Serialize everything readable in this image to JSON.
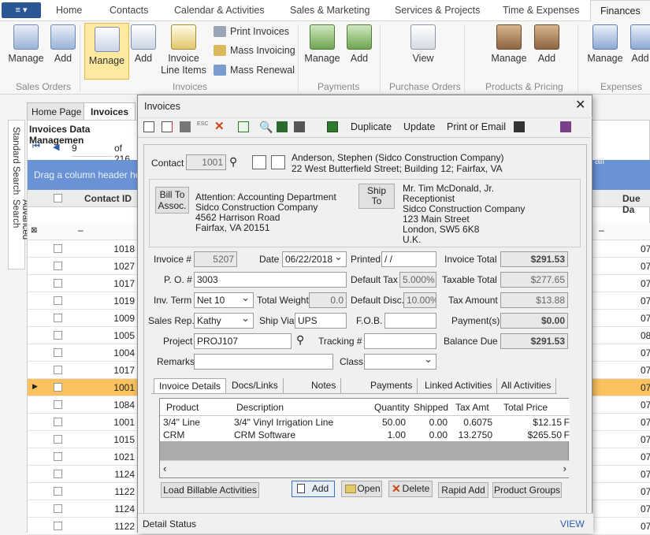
{
  "menu": {
    "app_button": "≡ ▾"
  },
  "ribbon_tabs": [
    "Home",
    "Contacts",
    "Calendar & Activities",
    "Sales & Marketing",
    "Services & Projects",
    "Time & Expenses",
    "Finances"
  ],
  "ribbon": {
    "sales_orders": {
      "manage": "Manage",
      "add": "Add",
      "label": "Sales Orders"
    },
    "invoices": {
      "manage": "Manage",
      "add": "Add",
      "line_items": "Invoice Line Items",
      "print": "Print Invoices",
      "mass": "Mass Invoicing",
      "renewal": "Mass Renewal",
      "label": "Invoices"
    },
    "payments": {
      "manage": "Manage",
      "add": "Add",
      "label": "Payments"
    },
    "purchase_orders": {
      "view": "View",
      "label": "Purchase Orders"
    },
    "products": {
      "manage": "Manage",
      "add": "Add",
      "label": "Products & Pricing"
    },
    "expenses": {
      "manage": "Manage",
      "add": "Add",
      "label": "Expenses"
    }
  },
  "background": {
    "tabs": {
      "home": "Home Page",
      "invoices": "Invoices"
    },
    "side": {
      "standard": "Standard Search",
      "advanced": "Advanced Search"
    },
    "title": "Invoices Data Managemen",
    "nav_value": "9",
    "nav_total": "of 216",
    "drag_hint": "Drag a column header he",
    "col_contact": "Contact ID",
    "col_due": "Due Da",
    "col_mail": "ail",
    "rows": [
      {
        "id": "1018",
        "due": "07"
      },
      {
        "id": "1027",
        "due": "07"
      },
      {
        "id": "1017",
        "due": "07"
      },
      {
        "id": "1019",
        "due": "07"
      },
      {
        "id": "1009",
        "due": "07"
      },
      {
        "id": "1005",
        "due": "08"
      },
      {
        "id": "1004",
        "due": "07"
      },
      {
        "id": "1017",
        "due": "07"
      },
      {
        "id": "1001",
        "due": "07"
      },
      {
        "id": "1084",
        "due": "07"
      },
      {
        "id": "1001",
        "due": "07"
      },
      {
        "id": "1015",
        "due": "07"
      },
      {
        "id": "1021",
        "due": "07"
      },
      {
        "id": "1124",
        "due": "07"
      },
      {
        "id": "1122",
        "due": "07"
      },
      {
        "id": "1124",
        "due": "07"
      },
      {
        "id": "1122",
        "due": "07"
      }
    ]
  },
  "dialog": {
    "title": "Invoices",
    "toolbar": {
      "duplicate": "Duplicate",
      "update": "Update",
      "print_email": "Print or Email"
    },
    "contact_label": "Contact",
    "contact_id": "1001",
    "contact_name": "Anderson, Stephen (Sidco Construction Company)",
    "contact_addr": "22 West Butterfield Street; Building 12; Fairfax, VA",
    "bill_to": "Bill To Assoc.",
    "bill_lines": [
      "Attention: Accounting Department",
      "Sidco Construction Company",
      "4562 Harrison Road",
      "Fairfax, VA 20151"
    ],
    "ship_to": "Ship To",
    "ship_lines": [
      "Mr. Tim McDonald, Jr.",
      "Receptionist",
      "Sidco Construction Company",
      "123 Main Street",
      "London,  SW5 6K8",
      "U.K."
    ],
    "invoice_no_label": "Invoice #",
    "invoice_no": "5207",
    "date_label": "Date",
    "date": "06/22/2018",
    "printed_label": "Printed",
    "printed": " / /",
    "invoice_total_label": "Invoice Total",
    "invoice_total": "$291.53",
    "po_label": "P. O. #",
    "po": "3003",
    "default_tax_label": "Default Tax",
    "default_tax": "5.000%",
    "taxable_total_label": "Taxable Total",
    "taxable_total": "$277.65",
    "term_label": "Inv. Term",
    "term": "Net 10",
    "weight_label": "Total Weight",
    "weight": "0.0",
    "default_disc_label": "Default Disc.",
    "default_disc": "10.00%",
    "tax_amount_label": "Tax Amount",
    "tax_amount": "$13.88",
    "rep_label": "Sales Rep.",
    "rep": "Kathy",
    "ship_via_label": "Ship Via",
    "ship_via": "UPS",
    "fob_label": "F.O.B.",
    "fob": "",
    "payments_label": "Payment(s)",
    "payments": "$0.00",
    "project_label": "Project",
    "project": "PROJ107",
    "tracking_label": "Tracking #",
    "tracking": "",
    "balance_label": "Balance Due",
    "balance": "$291.53",
    "remarks_label": "Remarks",
    "remarks": "",
    "class_label": "Class",
    "class": "",
    "inner_tabs": [
      "Invoice Details",
      "Docs/Links",
      "Notes",
      "Payments",
      "Linked Activities",
      "All Activities"
    ],
    "grid_headers": [
      "Product",
      "Description",
      "Quantity",
      "Shipped",
      "Tax Amt",
      "Total Price"
    ],
    "lines": [
      {
        "product": "3/4\" Line",
        "desc": "3/4\"  Vinyl Irrigation Line",
        "qty": "50.00",
        "shipped": "0.00",
        "tax": "0.6075",
        "total": "$12.15",
        "extra": "F"
      },
      {
        "product": "CRM",
        "desc": "CRM Software",
        "qty": "1.00",
        "shipped": "0.00",
        "tax": "13.2750",
        "total": "$265.50",
        "extra": "F"
      }
    ],
    "buttons": {
      "load": "Load Billable Activities",
      "add": "Add",
      "open": "Open",
      "delete": "Delete",
      "rapid": "Rapid Add",
      "groups": "Product Groups"
    },
    "status": "Detail Status",
    "view": "VIEW"
  }
}
